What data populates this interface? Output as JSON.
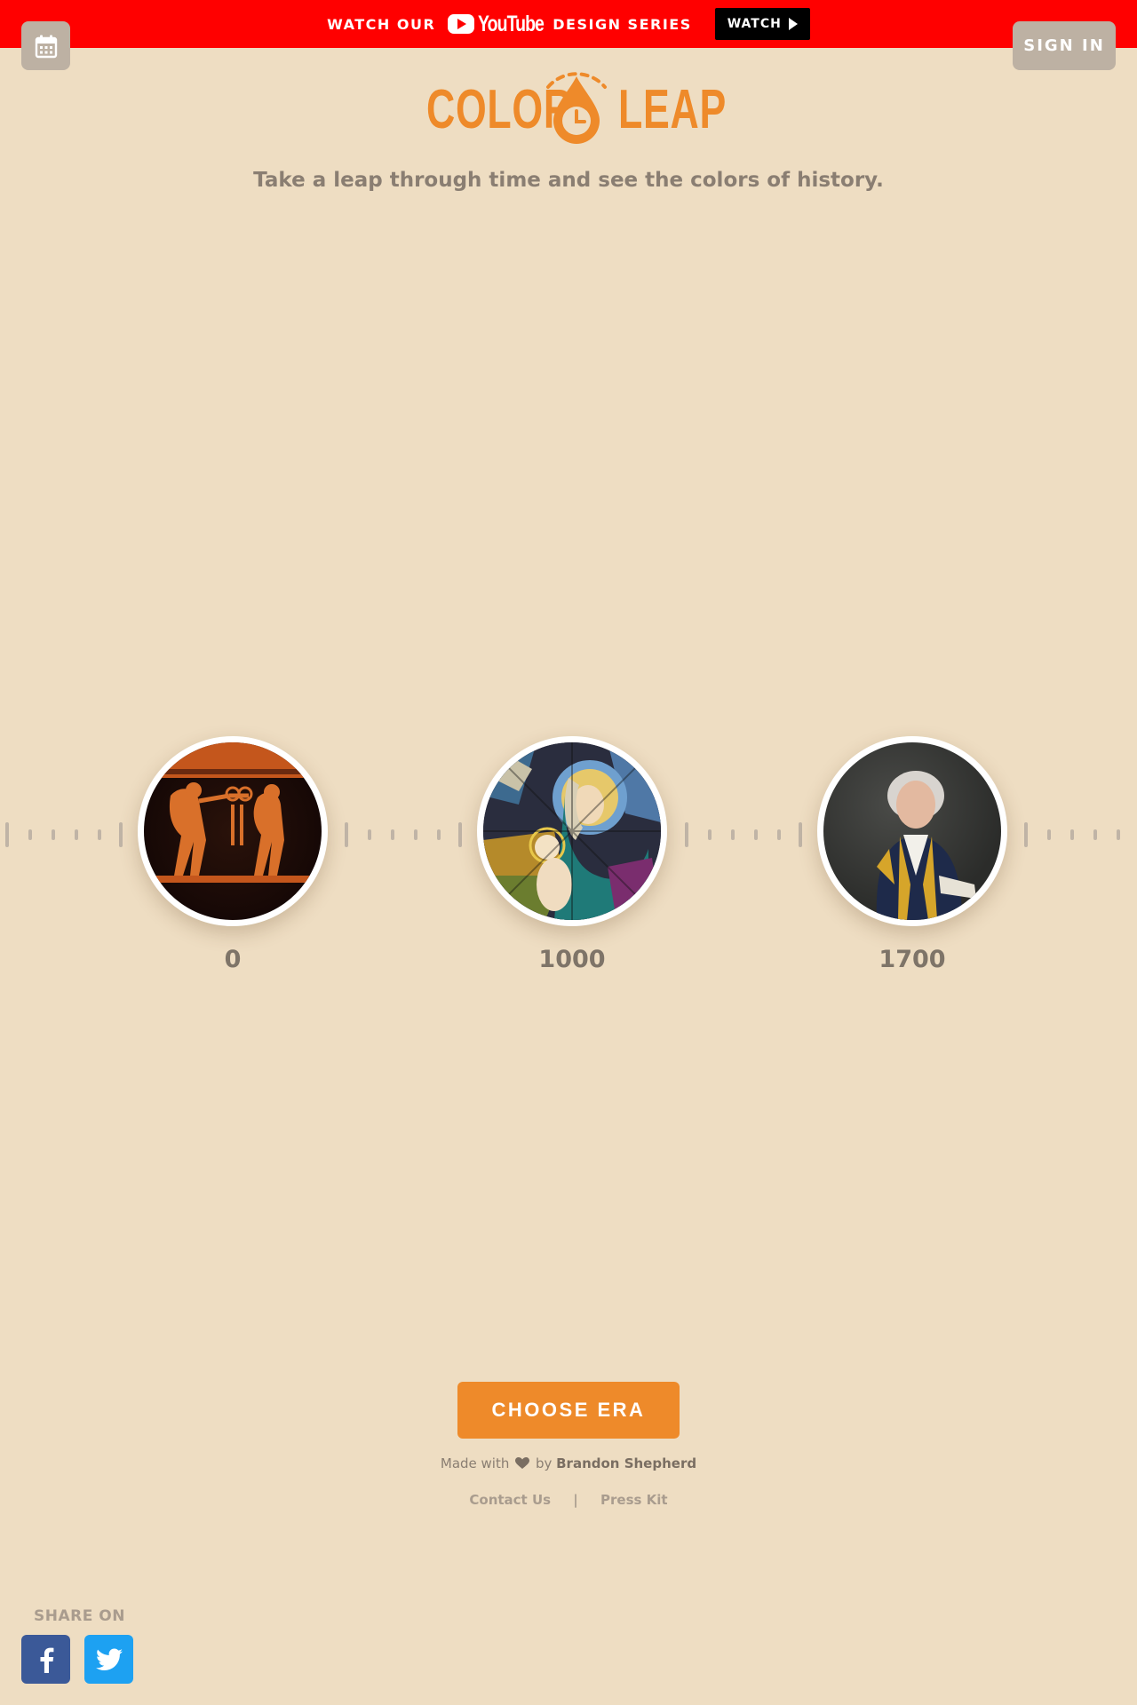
{
  "banner": {
    "watch_our": "WATCH OUR",
    "youtube_word": "YouTube",
    "design_series": "DESIGN SERIES",
    "watch_button": "WATCH",
    "background": "#FF0000"
  },
  "header": {
    "calendar_icon": "calendar-icon",
    "sign_in": "SIGN IN"
  },
  "logo": {
    "left": "COLOR",
    "right": "LEAP",
    "color": "#EE8A2A"
  },
  "tagline": "Take a leap through time and see the colors of history.",
  "timeline": {
    "eras": [
      {
        "label": "0",
        "image": "greek-vase-painting"
      },
      {
        "label": "1000",
        "image": "stained-glass-madonna"
      },
      {
        "label": "1700",
        "image": "naval-officer-portrait"
      }
    ]
  },
  "actions": {
    "choose_era": "CHOOSE ERA"
  },
  "footer": {
    "made_with": "Made with",
    "by": "by",
    "author": "Brandon Shepherd",
    "contact": "Contact Us",
    "separator": "|",
    "press_kit": "Press Kit"
  },
  "share": {
    "label": "SHARE ON",
    "facebook_icon": "facebook-icon",
    "twitter_icon": "twitter-icon"
  },
  "colors": {
    "page_background": "#EEDDC2",
    "accent": "#EE8A2A",
    "muted_button": "#BDB1A3",
    "facebook": "#3B5998",
    "twitter": "#1DA1F2"
  }
}
